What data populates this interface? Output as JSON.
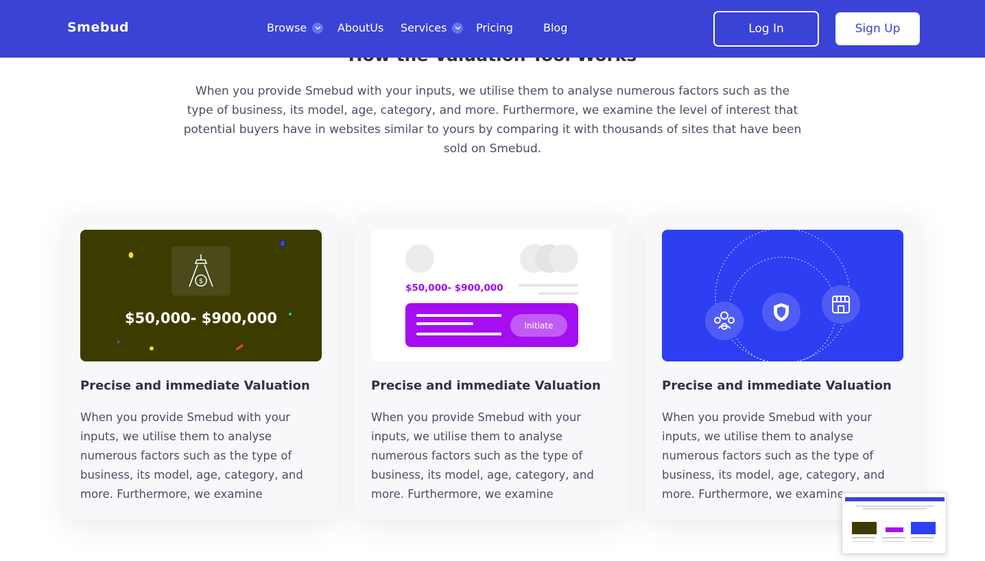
{
  "brand": {
    "name": "Smebud",
    "accent": "#3b43d6"
  },
  "nav": {
    "items": [
      {
        "label": "Browse",
        "has_dropdown": true
      },
      {
        "label": "AboutUs",
        "has_dropdown": false
      },
      {
        "label": "Services",
        "has_dropdown": true
      },
      {
        "label": "Pricing",
        "has_dropdown": false
      },
      {
        "label": "Blog",
        "has_dropdown": false
      }
    ],
    "login_label": "Log In",
    "signup_label": "Sign Up"
  },
  "section": {
    "title": "How the Valuation Tool Works",
    "description": "When you provide Smebud with your inputs, we utilise them to analyse numerous factors such as the type of business, its model, age, category, and more. Furthermore, we examine the level of interest that potential buyers have in websites similar to yours by comparing it with thousands of sites that have been sold on Smebud."
  },
  "cards": [
    {
      "title": "Precise and immediate Valuation",
      "text": "When you provide Smebud with your inputs, we utilise them to analyse numerous factors such as the type of business, its model, age, category, and more. Furthermore, we examine",
      "price": "$50,000- $900,000",
      "icon": "money-lamp-icon",
      "bg": "#3c3c00"
    },
    {
      "title": "Precise and immediate Valuation",
      "text": "When you provide Smebud with your inputs, we utilise them to analyse numerous factors such as the type of business, its model, age, category, and more. Furthermore, we examine",
      "price": "$50,000- $900,000",
      "button": "Initiate",
      "bg": "#ffffff"
    },
    {
      "title": "Precise and immediate Valuation",
      "text": "When you provide Smebud with your inputs, we utilise them to analyse numerous factors such as the type of business, its model, age, category, and more. Furthermore, we examine",
      "icons": [
        "people-icon",
        "shield-icon",
        "store-icon"
      ],
      "bg": "#2e3ef2"
    }
  ]
}
